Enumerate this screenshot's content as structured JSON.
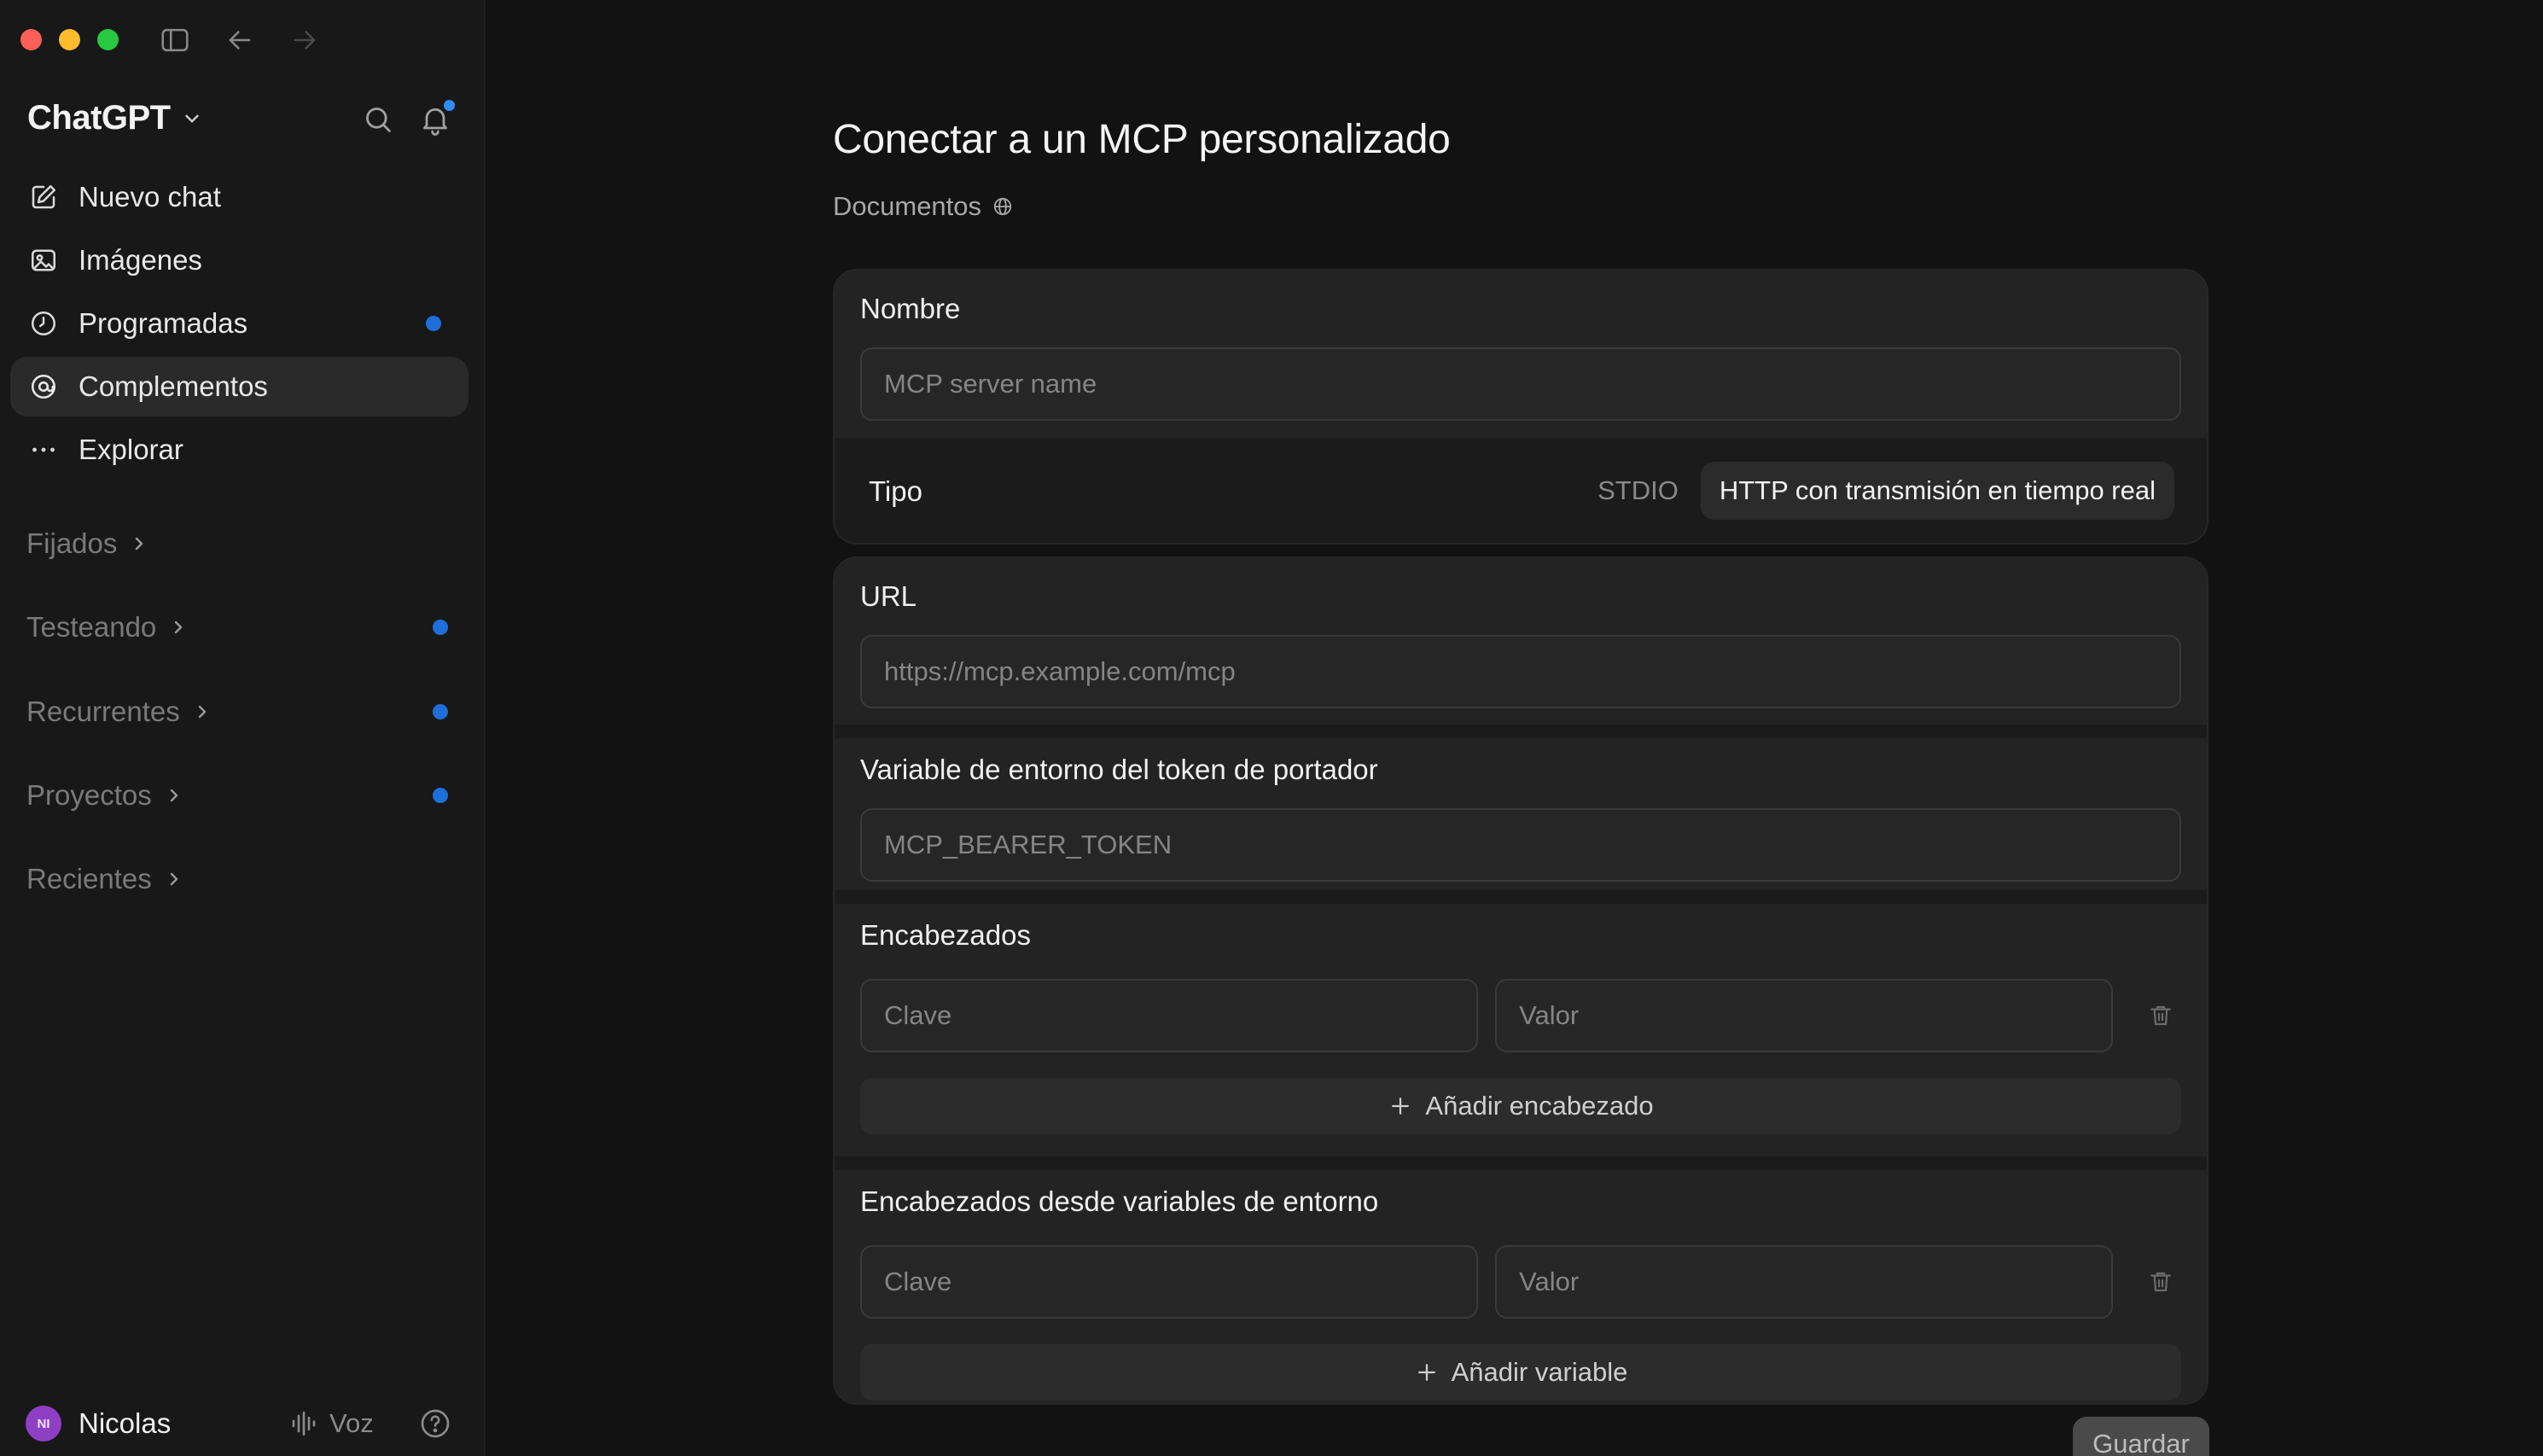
{
  "sidebar": {
    "brand": "ChatGPT",
    "nav": [
      {
        "label": "Nuevo chat",
        "icon": "edit-icon",
        "dot": false,
        "active": false
      },
      {
        "label": "Imágenes",
        "icon": "image-icon",
        "dot": false,
        "active": false
      },
      {
        "label": "Programadas",
        "icon": "clock-icon",
        "dot": true,
        "active": false
      },
      {
        "label": "Complementos",
        "icon": "at-icon",
        "dot": false,
        "active": true
      },
      {
        "label": "Explorar",
        "icon": "more-icon",
        "dot": false,
        "active": false
      }
    ],
    "sections": [
      {
        "label": "Fijados",
        "dot": false
      },
      {
        "label": "Testeando",
        "dot": true
      },
      {
        "label": "Recurrentes",
        "dot": true
      },
      {
        "label": "Proyectos",
        "dot": true
      },
      {
        "label": "Recientes",
        "dot": false
      }
    ],
    "user": {
      "initials": "NI",
      "name": "Nicolas",
      "avatar_color": "#8e3fc4"
    },
    "voice_label": "Voz"
  },
  "main": {
    "title": "Conectar a un MCP personalizado",
    "docs_label": "Documentos",
    "name_section": {
      "label": "Nombre",
      "placeholder": "MCP server name"
    },
    "type_section": {
      "label": "Tipo",
      "options": [
        "STDIO",
        "HTTP con transmisión en tiempo real"
      ],
      "selected": 1
    },
    "url_section": {
      "label": "URL",
      "placeholder": "https://mcp.example.com/mcp"
    },
    "token_section": {
      "label": "Variable de entorno del token de portador",
      "placeholder": "MCP_BEARER_TOKEN"
    },
    "headers_section": {
      "label": "Encabezados",
      "key_placeholder": "Clave",
      "value_placeholder": "Valor",
      "add_label": "Añadir encabezado"
    },
    "env_headers_section": {
      "label": "Encabezados desde variables de entorno",
      "key_placeholder": "Clave",
      "value_placeholder": "Valor",
      "add_label": "Añadir variable"
    },
    "save_label": "Guardar"
  },
  "colors": {
    "accent_dot": "#1e6fd9",
    "notification_dot": "#2f8cf4",
    "traffic_red": "#ff5f57",
    "traffic_yellow": "#febc2e",
    "traffic_green": "#28c840"
  }
}
